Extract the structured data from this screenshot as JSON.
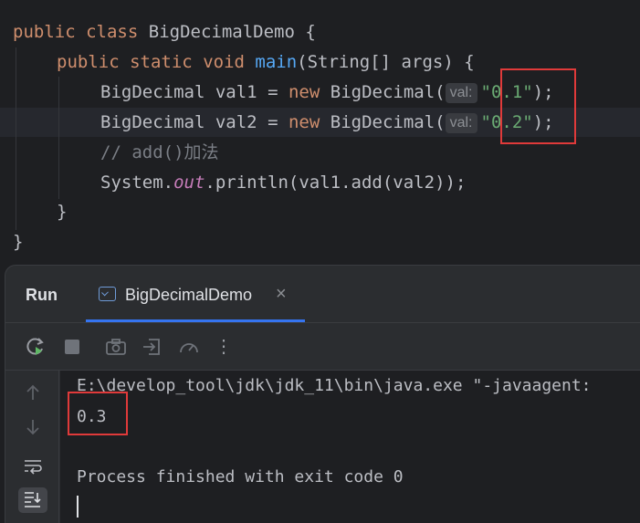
{
  "editor": {
    "line1": {
      "kw1": "public",
      "kw2": "class",
      "name": "BigDecimalDemo",
      "brace": "{"
    },
    "line2": {
      "kw1": "public",
      "kw2": "static",
      "kw3": "void",
      "method": "main",
      "params": "(String[] args) {"
    },
    "line3": {
      "type": "BigDecimal",
      "var": "val1",
      "eq": "=",
      "kw": "new",
      "ctor": "BigDecimal(",
      "hint": "val:",
      "value": "\"0.1\"",
      "end": ");"
    },
    "line4": {
      "type": "BigDecimal",
      "var": "val2",
      "eq": "=",
      "kw": "new",
      "ctor": "BigDecimal(",
      "hint": "val:",
      "value": "\"0.2\"",
      "end": ");"
    },
    "line5": {
      "comment": "// add()加法"
    },
    "line6": {
      "pre": "System.",
      "field": "out",
      "post": ".println(val1.add(val2));"
    },
    "line7": {
      "brace": "}"
    },
    "line8": {
      "brace": "}"
    }
  },
  "run_panel": {
    "title": "Run",
    "tab_label": "BigDecimalDemo",
    "tab_close": "×",
    "gutter_icons": [
      "arrow-up-icon",
      "arrow-down-icon",
      "soft-wrap-icon",
      "scroll-to-end-icon"
    ],
    "toolbar_icons": [
      "rerun-icon",
      "stop-icon",
      "camera-icon",
      "restore-layout-icon",
      "profiler-icon",
      "more-icon"
    ],
    "more_glyph": "⋮"
  },
  "console": {
    "command": "E:\\develop_tool\\jdk\\jdk_11\\bin\\java.exe \"-javaagent:",
    "result": "0.3",
    "blank": "",
    "exit_message": "Process finished with exit code 0"
  },
  "colors": {
    "keyword": "#cf8e6d",
    "method": "#56a8f5",
    "string": "#6aab73",
    "highlight_box": "#e03a3a",
    "tab_accent": "#3574f0"
  }
}
